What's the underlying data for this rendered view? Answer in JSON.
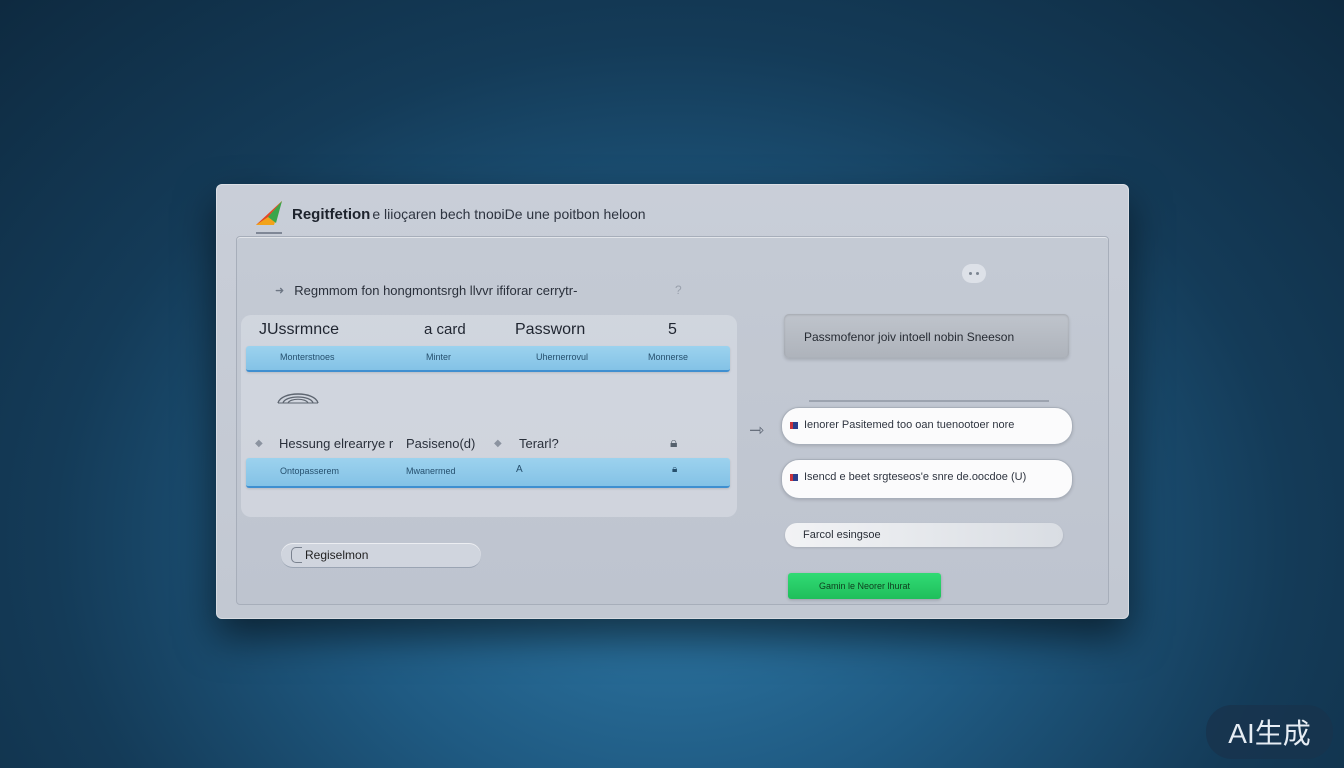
{
  "header": {
    "app_name": "Regitfetion",
    "subtitle": "e liioçaren bech  tnoɒiDe une poitbon heloon"
  },
  "left_panel": {
    "hint": "Regmmom fon hongmontsrgh llvvr ififorar cerrytr-",
    "hint_mark": "?",
    "columns": [
      "JUssrmnce",
      "a card",
      "Passworn",
      "5"
    ],
    "row1_cells": [
      "Monterstnoes",
      "Minter",
      "Uhernerrovul",
      "Monnerse"
    ],
    "labels": [
      "Hessung elrearrye r",
      "Pasiseno(d)",
      "Terarl?"
    ],
    "row2_cells": [
      "Ontopasserem",
      "Mwanermed",
      "A"
    ],
    "register_label": "Regiselmon"
  },
  "right_panel": {
    "top_field": "Passmofenor joiv intoell nobin Sneeson",
    "field1": "Ienorer  Pasitemed too oan tuenootoer nore",
    "field2": "Isencd  e  beet srgteseos'e snre de.oocdoe (U)",
    "field3": "Farcol esingsoe",
    "cta_label": "Gamin le Neorer lhurat"
  },
  "watermark": "AI生成",
  "colors": {
    "cta": "#27cc66",
    "bar": "#8fcaee",
    "bar_border": "#3f8fd0"
  },
  "icons": [
    "logo-icon",
    "arrow-right-icon",
    "fingerprint-icon",
    "eye-icon",
    "lock-icon",
    "chat-icon",
    "flag-icon"
  ]
}
